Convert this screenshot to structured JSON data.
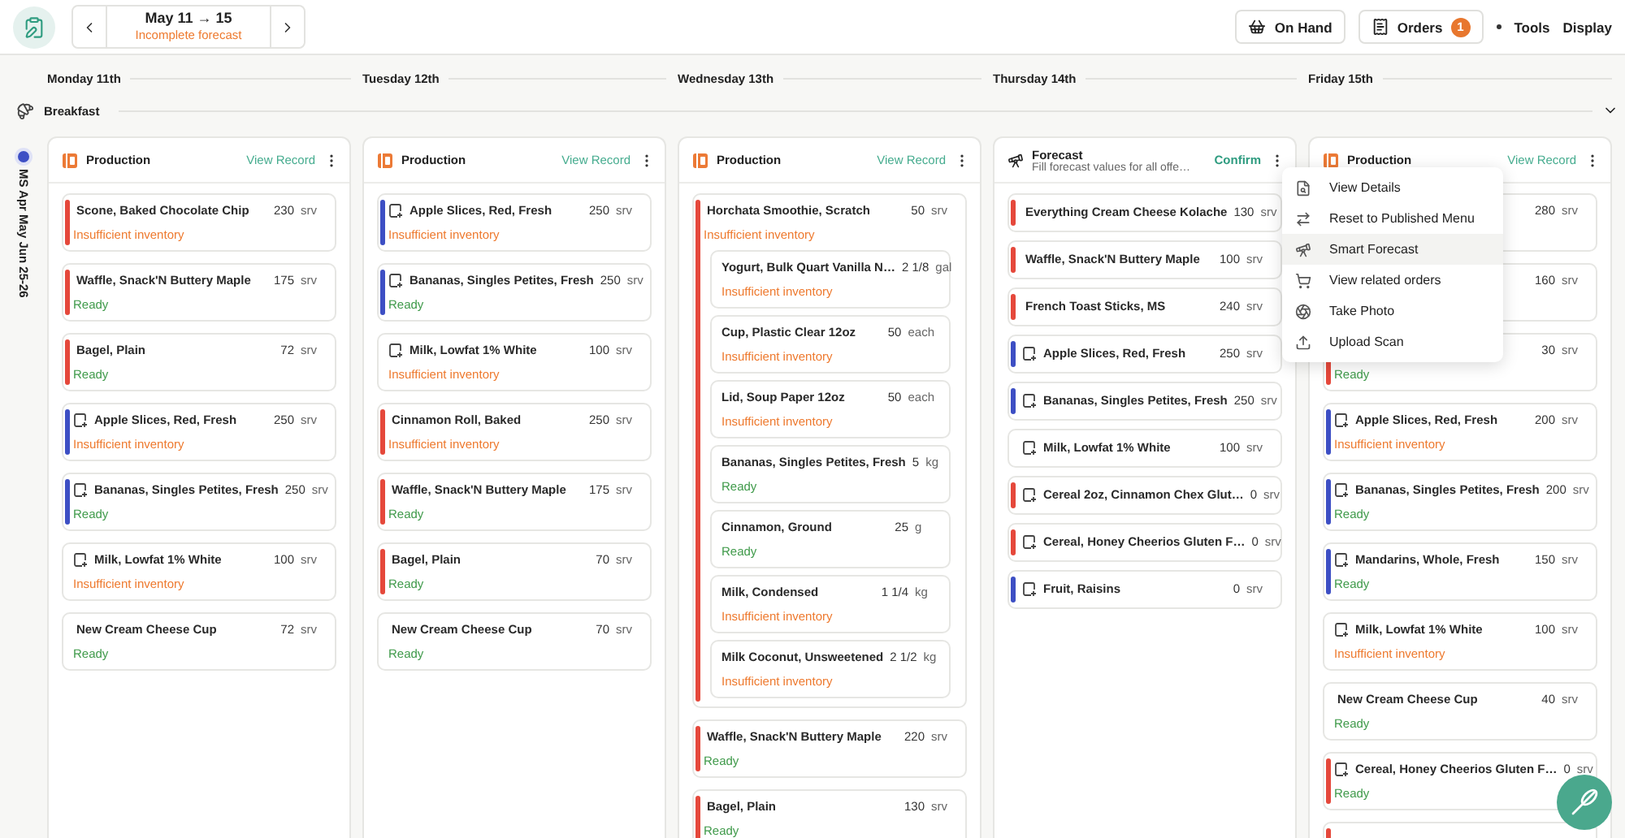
{
  "header": {
    "week": "May 11 → 15",
    "week_status": "Incomplete forecast",
    "buttons": [
      {
        "kind": "basket",
        "label": "On Hand"
      },
      {
        "kind": "orders",
        "label": "Orders",
        "badge": "1"
      }
    ],
    "links": [
      "Tools",
      "Display"
    ]
  },
  "days": [
    "Monday 11th",
    "Tuesday 12th",
    "Wednesday 13th",
    "Thursday 14th",
    "Friday 15th"
  ],
  "meal": {
    "label": "Breakfast",
    "expanded": true
  },
  "rail": {
    "label": "MS Apr May Jun 25-26"
  },
  "columns": [
    {
      "panel": {
        "kind": "production",
        "title": "Production",
        "action": "View Record",
        "cards": [
          {
            "kind": "plain",
            "name": "Scone, Baked Chocolate Chip",
            "qty": "230",
            "unit": "srv",
            "color": "#e5483b",
            "status": "Insufficient inventory",
            "ready": false
          },
          {
            "kind": "plain",
            "name": "Waffle, Snack'N Buttery Maple",
            "qty": "175",
            "unit": "srv",
            "color": "#e5483b",
            "status": "Ready",
            "ready": true
          },
          {
            "kind": "plain",
            "name": "Bagel, Plain",
            "qty": "72",
            "unit": "srv",
            "color": "#e5483b",
            "status": "Ready",
            "ready": true
          },
          {
            "kind": "item",
            "name": "Apple Slices, Red, Fresh",
            "qty": "250",
            "unit": "srv",
            "color": "#3d4fc4",
            "status": "Insufficient inventory",
            "ready": false
          },
          {
            "kind": "item",
            "name": "Bananas, Singles Petites, Fresh",
            "qty": "250",
            "unit": "srv",
            "color": "#3d4fc4",
            "status": "Ready",
            "ready": true
          },
          {
            "kind": "item",
            "name": "Milk, Lowfat 1% White",
            "qty": "100",
            "unit": "srv",
            "status": "Insufficient inventory",
            "ready": false
          },
          {
            "kind": "plain",
            "name": "New Cream Cheese Cup",
            "qty": "72",
            "unit": "srv",
            "status": "Ready",
            "ready": true
          }
        ]
      }
    },
    {
      "panel": {
        "kind": "production",
        "title": "Production",
        "action": "View Record",
        "cards": [
          {
            "kind": "item",
            "name": "Apple Slices, Red, Fresh",
            "qty": "250",
            "unit": "srv",
            "color": "#3d4fc4",
            "status": "Insufficient inventory",
            "ready": false
          },
          {
            "kind": "item",
            "name": "Bananas, Singles Petites, Fresh",
            "qty": "250",
            "unit": "srv",
            "color": "#3d4fc4",
            "status": "Ready",
            "ready": true
          },
          {
            "kind": "item",
            "name": "Milk, Lowfat 1% White",
            "qty": "100",
            "unit": "srv",
            "status": "Insufficient inventory",
            "ready": false
          },
          {
            "kind": "plain",
            "name": "Cinnamon Roll, Baked",
            "qty": "250",
            "unit": "srv",
            "color": "#e5483b",
            "status": "Insufficient inventory",
            "ready": false
          },
          {
            "kind": "plain",
            "name": "Waffle, Snack'N Buttery Maple",
            "qty": "175",
            "unit": "srv",
            "color": "#e5483b",
            "status": "Ready",
            "ready": true
          },
          {
            "kind": "plain",
            "name": "Bagel, Plain",
            "qty": "70",
            "unit": "srv",
            "color": "#e5483b",
            "status": "Ready",
            "ready": true
          },
          {
            "kind": "plain",
            "name": "New Cream Cheese Cup",
            "qty": "70",
            "unit": "srv",
            "status": "Ready",
            "ready": true
          }
        ]
      }
    },
    {
      "panel": {
        "kind": "production",
        "title": "Production",
        "action": "View Record",
        "cards": [
          {
            "kind": "plain",
            "name": "Horchata Smoothie, Scratch",
            "qty": "50",
            "unit": "srv",
            "color": "#e5483b",
            "status": "Insufficient inventory",
            "ready": false,
            "children": [
              {
                "name": "Yogurt, Bulk Quart Vanilla N…",
                "qty": "2 1/8",
                "unit": "gal",
                "status": "Insufficient inventory",
                "ready": false
              },
              {
                "name": "Cup, Plastic Clear 12oz",
                "qty": "50",
                "unit": "each",
                "status": "Insufficient inventory",
                "ready": false
              },
              {
                "name": "Lid, Soup Paper 12oz",
                "qty": "50",
                "unit": "each",
                "status": "Insufficient inventory",
                "ready": false
              },
              {
                "name": "Bananas, Singles Petites, Fresh",
                "qty": "5",
                "unit": "kg",
                "status": "Ready",
                "ready": true
              },
              {
                "name": "Cinnamon, Ground",
                "qty": "25",
                "unit": "g",
                "status": "Ready",
                "ready": true
              },
              {
                "name": "Milk, Condensed",
                "qty": "1 1/4",
                "unit": "kg",
                "status": "Insufficient inventory",
                "ready": false
              },
              {
                "name": "Milk Coconut, Unsweetened",
                "qty": "2 1/2",
                "unit": "kg",
                "status": "Insufficient inventory",
                "ready": false
              }
            ]
          },
          {
            "kind": "plain",
            "name": "Waffle, Snack'N Buttery Maple",
            "qty": "220",
            "unit": "srv",
            "color": "#e5483b",
            "status": "Ready",
            "ready": true
          },
          {
            "kind": "plain",
            "name": "Bagel, Plain",
            "qty": "130",
            "unit": "srv",
            "color": "#e5483b",
            "status": "Ready",
            "ready": true
          }
        ]
      }
    },
    {
      "panel": {
        "kind": "forecast",
        "title": "Forecast",
        "subtitle": "Fill forecast values for all offe…",
        "action": "Confirm",
        "cards": [
          {
            "kind": "plain",
            "name": "Everything Cream Cheese Kolache",
            "qty": "130",
            "unit": "srv",
            "color": "#e5483b"
          },
          {
            "kind": "plain",
            "name": "Waffle, Snack'N Buttery Maple",
            "qty": "100",
            "unit": "srv",
            "color": "#e5483b"
          },
          {
            "kind": "plain",
            "name": "French Toast Sticks, MS",
            "qty": "240",
            "unit": "srv",
            "color": "#e5483b"
          },
          {
            "kind": "item",
            "name": "Apple Slices, Red, Fresh",
            "qty": "250",
            "unit": "srv",
            "color": "#3d4fc4"
          },
          {
            "kind": "item",
            "name": "Bananas, Singles Petites, Fresh",
            "qty": "250",
            "unit": "srv",
            "color": "#3d4fc4"
          },
          {
            "kind": "item",
            "name": "Milk, Lowfat 1% White",
            "qty": "100",
            "unit": "srv"
          },
          {
            "kind": "item",
            "name": "Cereal 2oz, Cinnamon Chex Glut…",
            "qty": "0",
            "unit": "srv",
            "color": "#e5483b"
          },
          {
            "kind": "item",
            "name": "Cereal, Honey Cheerios Gluten F…",
            "qty": "0",
            "unit": "srv",
            "color": "#e5483b"
          },
          {
            "kind": "item",
            "name": "Fruit, Raisins",
            "qty": "0",
            "unit": "srv",
            "color": "#3d4fc4"
          }
        ]
      }
    },
    {
      "panel": {
        "kind": "production",
        "title": "Production",
        "action": "View Record",
        "cards": [
          {
            "kind": "plain",
            "qty": "280",
            "unit": "srv"
          },
          {
            "kind": "plain",
            "qty": "160",
            "unit": "srv"
          },
          {
            "kind": "plain",
            "qty": "30",
            "unit": "srv",
            "color": "#e5483b",
            "status": "Ready",
            "ready": true
          },
          {
            "kind": "item",
            "name": "Apple Slices, Red, Fresh",
            "qty": "200",
            "unit": "srv",
            "color": "#3d4fc4",
            "status": "Insufficient inventory",
            "ready": false
          },
          {
            "kind": "item",
            "name": "Bananas, Singles Petites, Fresh",
            "qty": "200",
            "unit": "srv",
            "color": "#3d4fc4",
            "status": "Ready",
            "ready": true
          },
          {
            "kind": "item",
            "name": "Mandarins, Whole, Fresh",
            "qty": "150",
            "unit": "srv",
            "color": "#3d4fc4",
            "status": "Ready",
            "ready": true
          },
          {
            "kind": "item",
            "name": "Milk, Lowfat 1% White",
            "qty": "100",
            "unit": "srv",
            "status": "Insufficient inventory",
            "ready": false
          },
          {
            "kind": "plain",
            "name": "New Cream Cheese Cup",
            "qty": "40",
            "unit": "srv",
            "status": "Ready",
            "ready": true
          },
          {
            "kind": "item",
            "name": "Cereal, Honey Cheerios Gluten F…",
            "qty": "0",
            "unit": "srv",
            "color": "#e5483b",
            "status": "Ready",
            "ready": true
          },
          {
            "kind": "plain",
            "color": "#e5483b"
          }
        ]
      }
    }
  ],
  "menu": {
    "items": [
      {
        "kind": "details",
        "label": "View Details",
        "highlighted": false
      },
      {
        "kind": "reset",
        "label": "Reset to Published Menu",
        "highlighted": false
      },
      {
        "kind": "forecast",
        "label": "Smart Forecast",
        "highlighted": true
      },
      {
        "kind": "orders",
        "label": "View related orders",
        "highlighted": false
      },
      {
        "kind": "photo",
        "label": "Take Photo",
        "highlighted": false
      },
      {
        "kind": "upload",
        "label": "Upload Scan",
        "highlighted": false
      }
    ]
  }
}
